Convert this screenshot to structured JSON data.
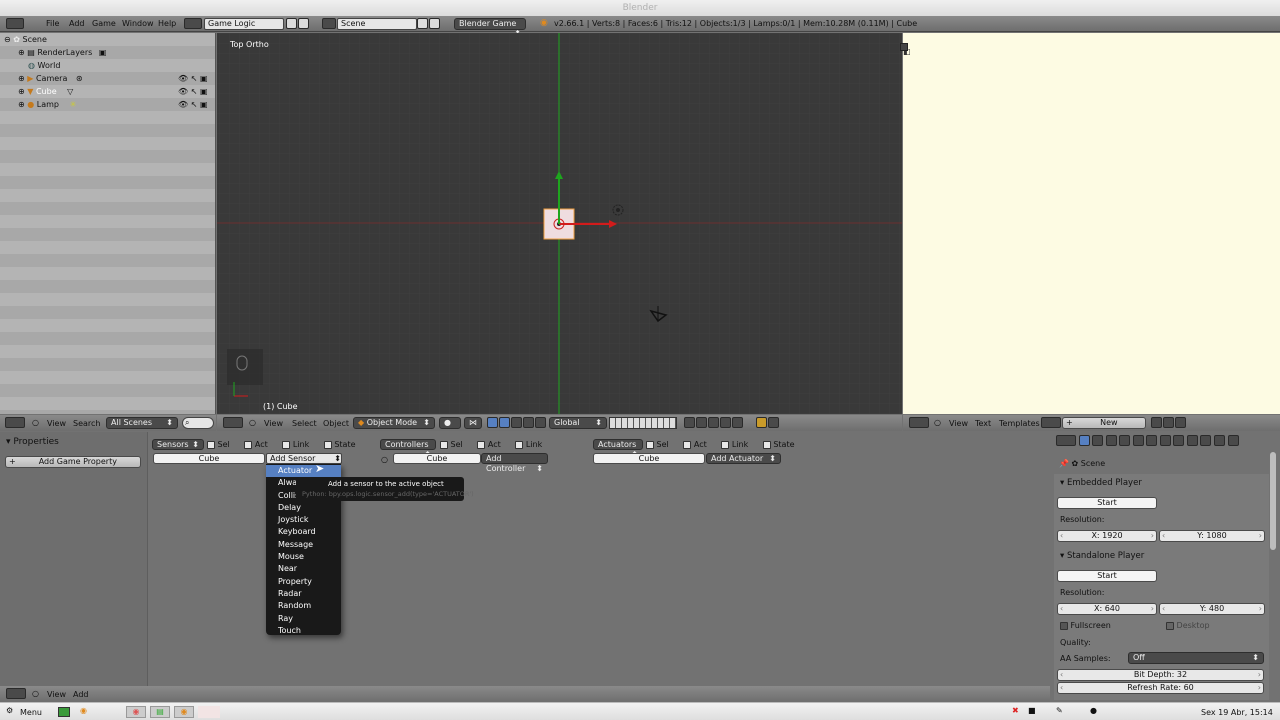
{
  "window": {
    "title": "Blender"
  },
  "topbar": {
    "menus": [
      "File",
      "Add",
      "Game",
      "Window",
      "Help"
    ],
    "screen_layout": "Game Logic",
    "scene": "Scene",
    "engine": "Blender Game",
    "stats": "v2.66.1 | Verts:8 | Faces:6 | Tris:12 | Objects:1/3 | Lamps:0/1 | Mem:10.28M (0.11M) | Cube"
  },
  "outliner": {
    "items": [
      {
        "label": "Scene",
        "indent": 0
      },
      {
        "label": "RenderLayers",
        "indent": 1
      },
      {
        "label": "World",
        "indent": 1
      },
      {
        "label": "Camera",
        "indent": 1
      },
      {
        "label": "Cube",
        "indent": 1
      },
      {
        "label": "Lamp",
        "indent": 1
      }
    ],
    "header": {
      "view": "View",
      "search": "Search",
      "filter": "All Scenes"
    }
  },
  "viewport": {
    "view_label": "Top Ortho",
    "object_label": "(1) Cube",
    "header": {
      "view": "View",
      "select": "Select",
      "object": "Object",
      "mode": "Object Mode",
      "orientation": "Global"
    }
  },
  "text_editor": {
    "header": {
      "view": "View",
      "text": "Text",
      "templates": "Templates",
      "new": "New"
    }
  },
  "logic_editor": {
    "properties_title": "Properties",
    "add_game_property": "Add Game Property",
    "sensors": {
      "label": "Sensors",
      "sel": "Sel",
      "act": "Act",
      "link": "Link",
      "state": "State",
      "object": "Cube",
      "add": "Add Sensor"
    },
    "controllers": {
      "label": "Controllers",
      "sel": "Sel",
      "act": "Act",
      "link": "Link",
      "object": "Cube",
      "add": "Add Controller"
    },
    "actuators": {
      "label": "Actuators",
      "sel": "Sel",
      "act": "Act",
      "link": "Link",
      "state": "State",
      "object": "Cube",
      "add": "Add Actuator"
    },
    "sensor_menu": [
      "Actuator",
      "Always",
      "Collision",
      "Delay",
      "Joystick",
      "Keyboard",
      "Message",
      "Mouse",
      "Near",
      "Property",
      "Radar",
      "Random",
      "Ray",
      "Touch"
    ],
    "sensor_menu_visible": [
      "Actuator",
      "Alwa",
      "Collis",
      "Delay",
      "Joystick",
      "Keyboard",
      "Message",
      "Mouse",
      "Near",
      "Property",
      "Radar",
      "Random",
      "Ray",
      "Touch"
    ],
    "tooltip": {
      "title": "Add a sensor to the active object",
      "python": "Python: bpy.ops.logic.sensor_add(type='ACTUATOR')"
    },
    "bottom_header": {
      "view": "View",
      "add": "Add"
    }
  },
  "render_properties": {
    "context": "Scene",
    "embedded": {
      "title": "Embedded Player",
      "start": "Start",
      "resolution_label": "Resolution:",
      "x": "X: 1920",
      "y": "Y: 1080"
    },
    "standalone": {
      "title": "Standalone Player",
      "start": "Start",
      "resolution_label": "Resolution:",
      "x": "X: 640",
      "y": "Y: 480",
      "fullscreen": "Fullscreen",
      "desktop": "Desktop"
    },
    "quality_label": "Quality:",
    "aa_label": "AA Samples:",
    "aa_value": "Off",
    "bit_depth": "Bit Depth: 32",
    "refresh_rate": "Refresh Rate: 60"
  },
  "taskbar": {
    "menu": "Menu",
    "clock": "Sex 19 Abr, 15:14"
  },
  "colors": {
    "accent_blue": "#5680c2",
    "viewport_bg": "#393939",
    "text_editor_bg": "#fdfbe3",
    "axis_green": "#1ea51e",
    "axis_red": "#d21b1b"
  }
}
